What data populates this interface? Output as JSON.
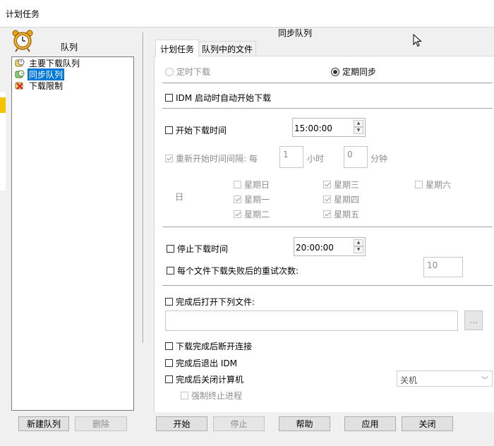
{
  "window": {
    "title": "计划任务"
  },
  "left": {
    "header": "队列",
    "items": [
      {
        "label": "主要下载队列",
        "icon": "queue-icon"
      },
      {
        "label": "同步队列",
        "icon": "sync-queue-icon",
        "selected": true
      },
      {
        "label": "下载限制",
        "icon": "limit-icon"
      }
    ],
    "new_button": "新建队列",
    "delete_button": "删除"
  },
  "main": {
    "title": "同步队列",
    "tabs": [
      {
        "label": "计划任务",
        "active": true
      },
      {
        "label": "队列中的文件"
      }
    ],
    "mode": {
      "one_time": "定时下载",
      "periodic": "定期同步"
    },
    "start_on_idm": "IDM 启动时自动开始下载",
    "start_time": {
      "label": "开始下载时间",
      "value": "15:00:00"
    },
    "repeat": {
      "label": "重新开始时间间隔: 每",
      "hours": "1",
      "hours_unit": "小时",
      "minutes": "0",
      "minutes_unit": "分钟"
    },
    "day_header": "日",
    "days": {
      "sun": "星期日",
      "mon": "星期一",
      "tue": "星期二",
      "wed": "星期三",
      "thu": "星期四",
      "fri": "星期五",
      "sat": "星期六"
    },
    "stop_time": {
      "label": "停止下载时间",
      "value": "20:00:00"
    },
    "retry": {
      "label": "每个文件下载失败后的重试次数:",
      "value": "10"
    },
    "open_file": {
      "label": "完成后打开下列文件:",
      "path": "",
      "browse": "..."
    },
    "hangup": "下载完成后断开连接",
    "exit_idm": "完成后退出 IDM",
    "shutdown": {
      "label": "完成后关闭计算机",
      "option": "关机"
    },
    "force": "强制终止进程"
  },
  "footer": {
    "start": "开始",
    "stop": "停止",
    "help": "帮助",
    "apply": "应用",
    "close": "关闭"
  },
  "colors": {
    "selection": "#0078d7",
    "window_bg": "#f0f0f0"
  }
}
